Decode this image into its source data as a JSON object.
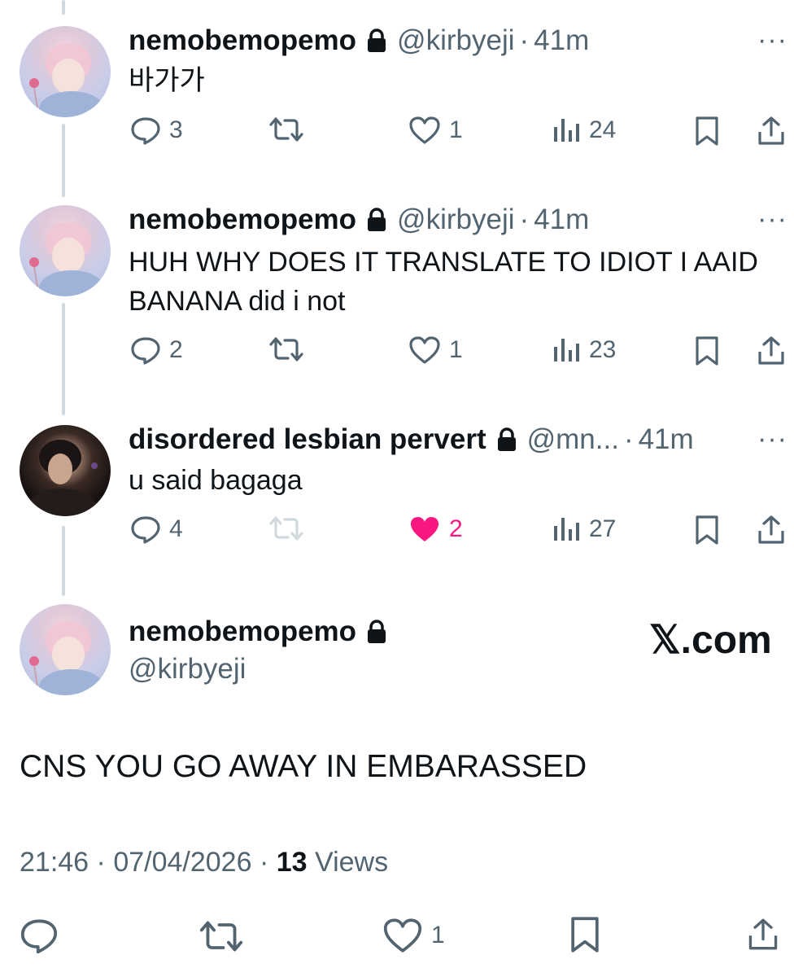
{
  "colors": {
    "text": "#0f1419",
    "muted": "#536471",
    "like": "#f91880",
    "thread": "#cfd9de"
  },
  "tweets": [
    {
      "name": "nemobemopemo",
      "handle": "@kirbyeji",
      "dot": "·",
      "time": "41m",
      "text": "바가가",
      "more": "···",
      "replies": "3",
      "retweets": "",
      "likes": "1",
      "views": "24",
      "liked": false
    },
    {
      "name": "nemobemopemo",
      "handle": "@kirbyeji",
      "dot": "·",
      "time": "41m",
      "text": "HUH WHY DOES IT TRANSLATE TO IDIOT I AAID BANANA did i not",
      "more": "···",
      "replies": "2",
      "retweets": "",
      "likes": "1",
      "views": "23",
      "liked": false
    },
    {
      "name": "disordered lesbian pervert",
      "handle": "@mn...",
      "dot": "·",
      "time": "41m",
      "text": "u said bagaga",
      "more": "···",
      "replies": "4",
      "retweets": "",
      "likes": "2",
      "views": "27",
      "liked": true
    }
  ],
  "main": {
    "name": "nemobemopemo",
    "handle": "@kirbyeji",
    "watermark": "𝕏.com",
    "text": "CNS YOU GO AWAY IN EMBARASSED",
    "time": "21:46",
    "date": "07/04/2026",
    "sep": "·",
    "views_count": "13",
    "views_label": "Views",
    "likes": "1"
  }
}
